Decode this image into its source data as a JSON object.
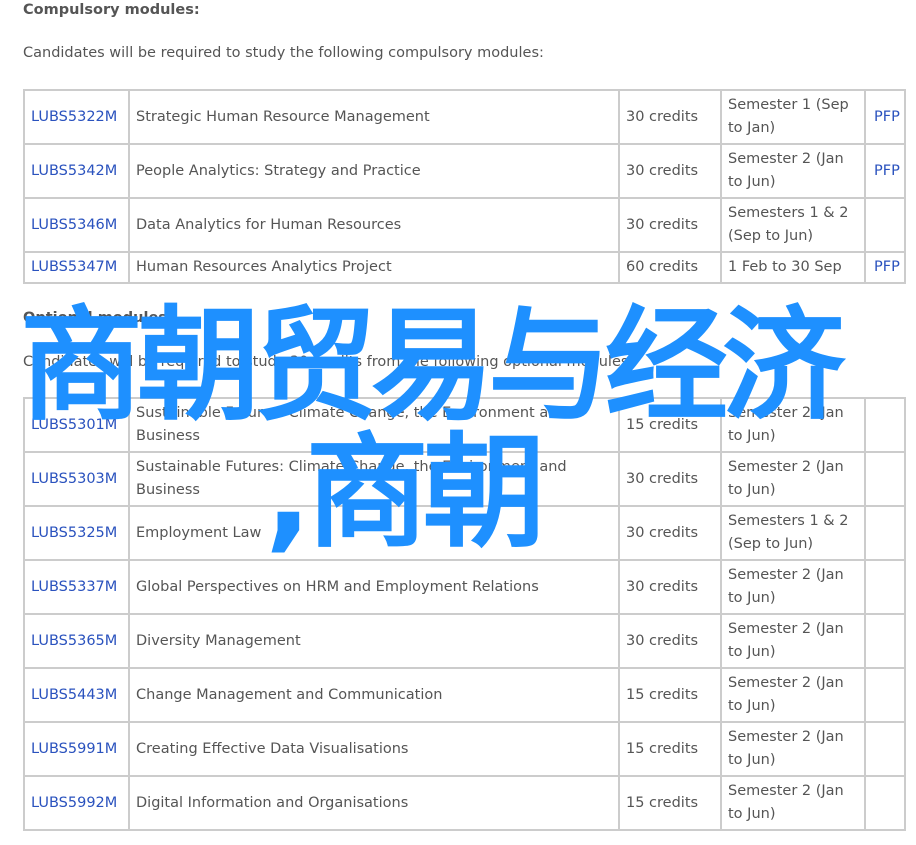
{
  "compulsory": {
    "heading": "Compulsory modules:",
    "intro": "Candidates will be required to study the following compulsory modules:",
    "rows": [
      {
        "code": "LUBS5322M",
        "title": "Strategic Human Resource Management",
        "credits": "30 credits",
        "semester": "Semester 1 (Sep to Jan)",
        "pfp": "PFP"
      },
      {
        "code": "LUBS5342M",
        "title": "People Analytics: Strategy and Practice",
        "credits": "30 credits",
        "semester": "Semester 2 (Jan to Jun)",
        "pfp": "PFP"
      },
      {
        "code": "LUBS5346M",
        "title": "Data Analytics for Human Resources",
        "credits": "30 credits",
        "semester": "Semesters 1 & 2 (Sep to Jun)",
        "pfp": ""
      },
      {
        "code": "LUBS5347M",
        "title": "Human Resources Analytics Project",
        "credits": "60 credits",
        "semester": "1 Feb to 30 Sep",
        "pfp": "PFP"
      }
    ]
  },
  "optional": {
    "heading": "Optional modules:",
    "intro": "Candidates will be required to study 30 credits from the following optional modules:",
    "rows": [
      {
        "code": "LUBS5301M",
        "title": "Sustainable Futures: Climate Change, the Environment and Business",
        "credits": "15 credits",
        "semester": "Semester 2 (Jan to Jun)",
        "pfp": ""
      },
      {
        "code": "LUBS5303M",
        "title": "Sustainable Futures: Climate Change, the Environment and Business",
        "credits": "30 credits",
        "semester": "Semester 2 (Jan to Jun)",
        "pfp": ""
      },
      {
        "code": "LUBS5325M",
        "title": "Employment Law",
        "credits": "30 credits",
        "semester": "Semesters 1 & 2 (Sep to Jun)",
        "pfp": ""
      },
      {
        "code": "LUBS5337M",
        "title": "Global Perspectives on HRM and Employment Relations",
        "credits": "30 credits",
        "semester": "Semester 2 (Jan to Jun)",
        "pfp": ""
      },
      {
        "code": "LUBS5365M",
        "title": "Diversity Management",
        "credits": "30 credits",
        "semester": "Semester 2 (Jan to Jun)",
        "pfp": ""
      },
      {
        "code": "LUBS5443M",
        "title": "Change Management and Communication",
        "credits": "15 credits",
        "semester": "Semester 2 (Jan to Jun)",
        "pfp": ""
      },
      {
        "code": "LUBS5991M",
        "title": "Creating Effective Data Visualisations",
        "credits": "15 credits",
        "semester": "Semester 2 (Jan to Jun)",
        "pfp": ""
      },
      {
        "code": "LUBS5992M",
        "title": "Digital Information and Organisations",
        "credits": "15 credits",
        "semester": "Semester 2 (Jan to Jun)",
        "pfp": ""
      }
    ]
  },
  "watermark": {
    "line1": "商朝贸易与经济",
    "line2": ",商朝",
    "color": "#1e90ff"
  }
}
